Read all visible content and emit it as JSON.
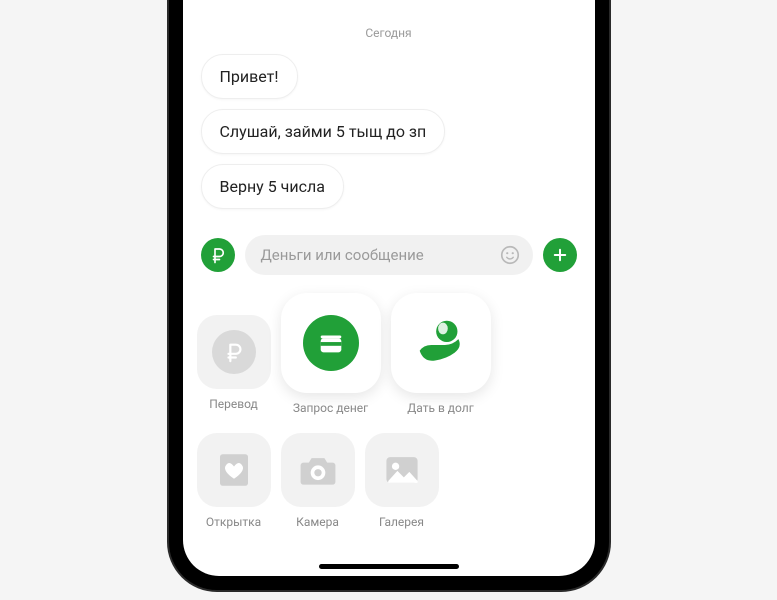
{
  "date_label": "Сегодня",
  "messages": [
    "Привет!",
    "Слушай, займи 5 тыщ до зп",
    "Верну 5 числа"
  ],
  "input": {
    "placeholder": "Деньги или сообщение"
  },
  "actions_row1": [
    {
      "label": "Перевод",
      "icon": "ruble"
    },
    {
      "label": "Запрос денег",
      "icon": "request"
    },
    {
      "label": "Дать в долг",
      "icon": "lend"
    }
  ],
  "actions_row2": [
    {
      "label": "Открытка",
      "icon": "postcard"
    },
    {
      "label": "Камера",
      "icon": "camera"
    },
    {
      "label": "Галерея",
      "icon": "gallery"
    }
  ],
  "colors": {
    "accent": "#21a038",
    "muted": "#d9d9d9"
  }
}
